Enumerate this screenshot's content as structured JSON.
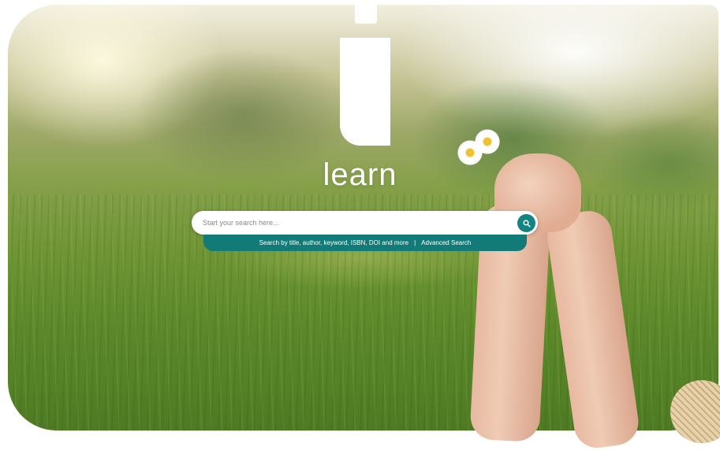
{
  "brand": {
    "wordmark": "learn"
  },
  "search": {
    "placeholder": "Start your search here...",
    "value": "",
    "hint_text": "Search by title, author, keyword, ISBN, DOI and more",
    "separator": "|",
    "advanced_label": "Advanced Search",
    "button_icon": "search-icon"
  },
  "colors": {
    "accent": "#138480",
    "strip": "#127b78",
    "logo": "#ffffff"
  }
}
